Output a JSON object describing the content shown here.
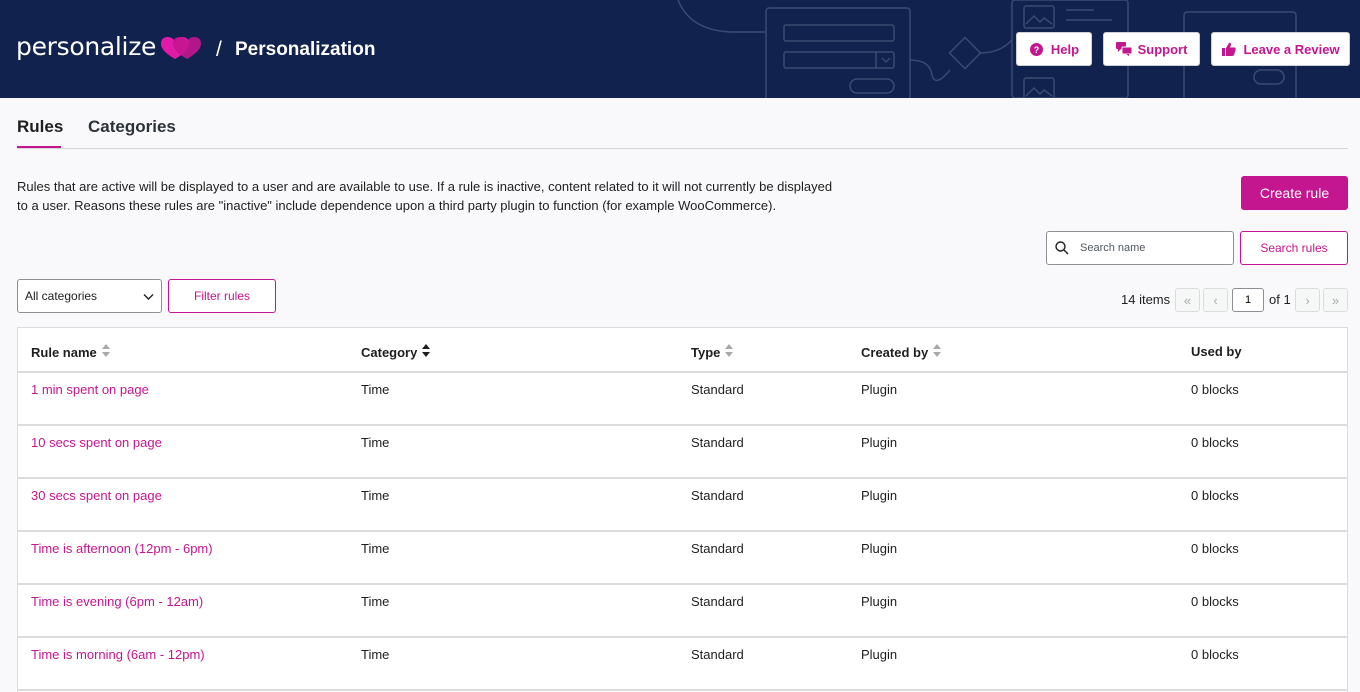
{
  "header": {
    "brand": "personalize",
    "separator": "/",
    "title": "Personalization",
    "buttons": {
      "help": "Help",
      "support": "Support",
      "review": "Leave a Review"
    }
  },
  "tabs": {
    "rules": "Rules",
    "categories": "Categories",
    "active": "Rules"
  },
  "description": "Rules that are active will be displayed to a user and are available to use. If a rule is inactive, content related to it will not currently be displayed to a user. Reasons these rules are \"inactive\" include dependence upon a third party plugin to function (for example WooCommerce).",
  "actions": {
    "create_rule": "Create rule",
    "search_placeholder": "Search name",
    "search_button": "Search rules",
    "category_select": "All categories",
    "filter_button": "Filter rules"
  },
  "pagination": {
    "count": "14 items",
    "first": "«",
    "prev": "‹",
    "current": "1",
    "of": "of 1",
    "next": "›",
    "last": "»"
  },
  "table": {
    "columns": [
      "Rule name",
      "Category",
      "Type",
      "Created by",
      "Used by"
    ],
    "rows": [
      [
        "1 min spent on page",
        "Time",
        "Standard",
        "Plugin",
        "0 blocks"
      ],
      [
        "10 secs spent on page",
        "Time",
        "Standard",
        "Plugin",
        "0 blocks"
      ],
      [
        "30 secs spent on page",
        "Time",
        "Standard",
        "Plugin",
        "0 blocks"
      ],
      [
        "Time is afternoon (12pm - 6pm)",
        "Time",
        "Standard",
        "Plugin",
        "0 blocks"
      ],
      [
        "Time is evening (6pm - 12am)",
        "Time",
        "Standard",
        "Plugin",
        "0 blocks"
      ],
      [
        "Time is morning (6am - 12pm)",
        "Time",
        "Standard",
        "Plugin",
        "0 blocks"
      ]
    ]
  },
  "colors": {
    "accent": "#c3168f",
    "header_bg": "#10224d",
    "page_bg": "#f9f9fb"
  }
}
